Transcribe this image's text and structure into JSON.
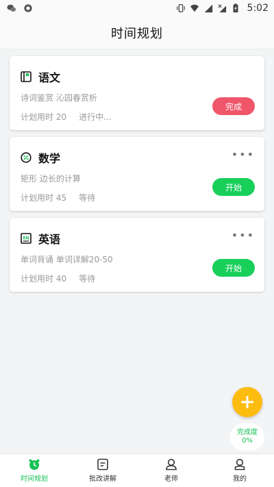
{
  "status_bar": {
    "time": "5:02"
  },
  "header": {
    "title": "时间规划"
  },
  "cards": [
    {
      "subject": "语文",
      "icon": "book-icon",
      "desc": "诗词鉴赏 沁园春赏析",
      "plan": "计划用时 20",
      "status": "进行中...",
      "button": "完成",
      "button_type": "done",
      "has_more": false
    },
    {
      "subject": "数学",
      "icon": "percent-icon",
      "desc": "矩形 边长的计算",
      "plan": "计划用时 45",
      "status": "等待",
      "button": "开始",
      "button_type": "start",
      "has_more": true
    },
    {
      "subject": "英语",
      "icon": "en-icon",
      "desc": "单词背诵 单词详解20-50",
      "plan": "计划用时 40",
      "status": "等待",
      "button": "开始",
      "button_type": "start",
      "has_more": true
    }
  ],
  "progress": {
    "label": "完成度",
    "value": "0%"
  },
  "tabs": [
    {
      "label": "时间规划",
      "icon": "alarm-clock-icon",
      "active": true
    },
    {
      "label": "批改讲解",
      "icon": "document-icon",
      "active": false
    },
    {
      "label": "老师",
      "icon": "teacher-icon",
      "active": false
    },
    {
      "label": "我的",
      "icon": "user-icon",
      "active": false
    }
  ],
  "colors": {
    "accent": "#18c257",
    "done": "#f0566a",
    "start": "#18cf5a",
    "fab": "#fdbc10"
  }
}
